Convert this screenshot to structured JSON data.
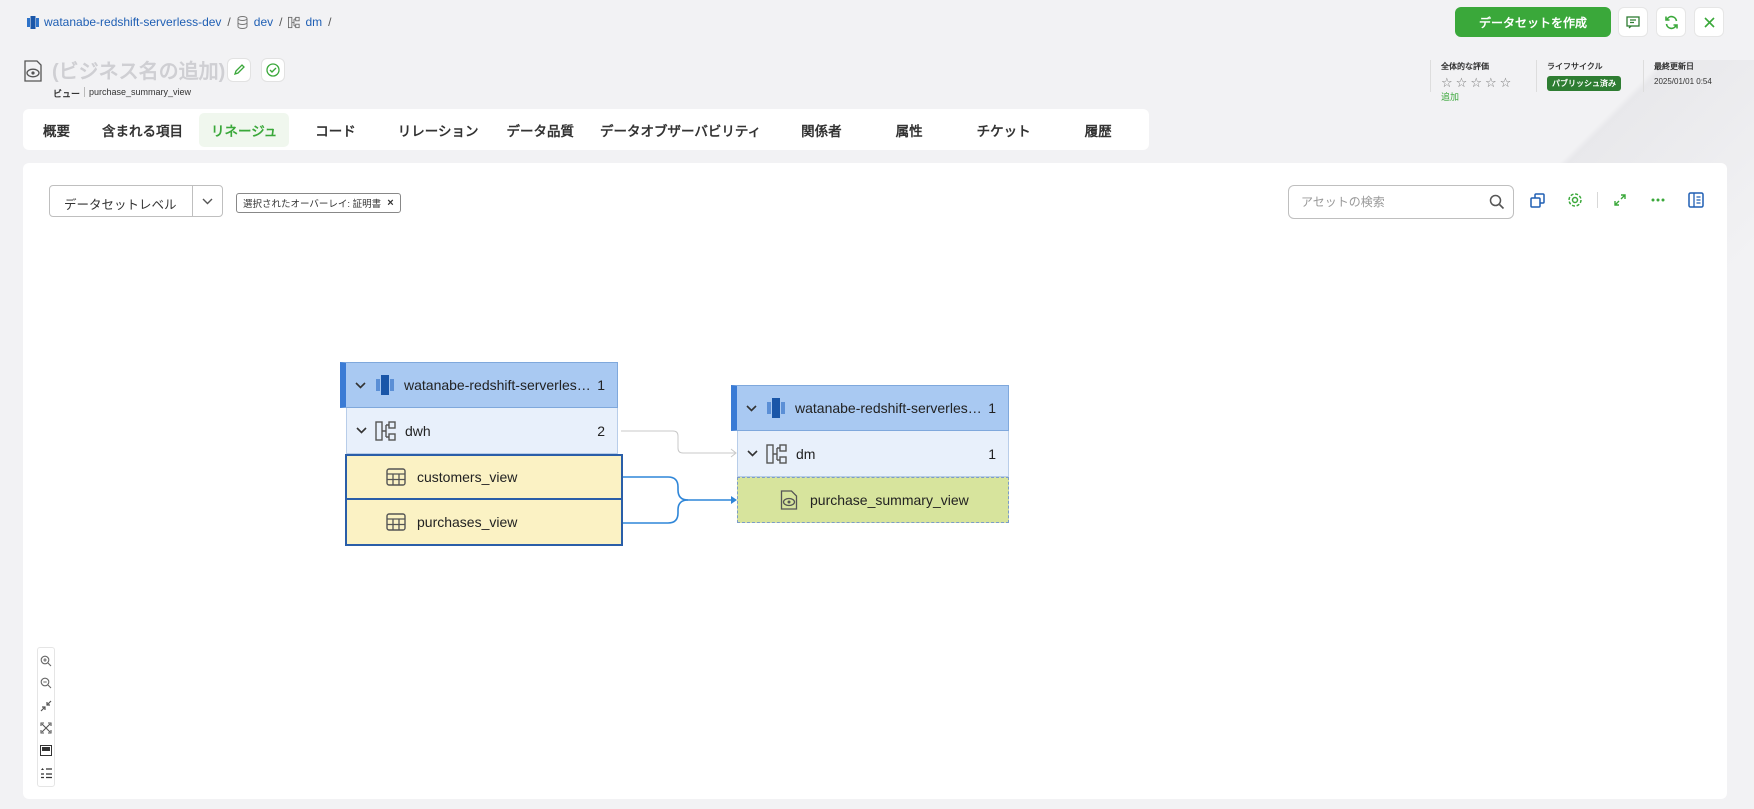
{
  "breadcrumb": [
    {
      "label": "watanabe-redshift-serverless-dev",
      "icon": "redshift-icon"
    },
    {
      "label": "dev",
      "icon": "database-icon"
    },
    {
      "label": "dm",
      "icon": "schema-icon"
    }
  ],
  "breadcrumb_sep": "/",
  "actions": {
    "create_dataset": "データセットを作成"
  },
  "asset": {
    "title": "(ビジネス名の追加)",
    "type_label": "ビュー",
    "name": "purchase_summary_view"
  },
  "meta": {
    "rating_label": "全体的な評価",
    "rating_add": "追加",
    "lifecycle_label": "ライフサイクル",
    "lifecycle_value": "パブリッシュ済み",
    "updated_label": "最終更新日",
    "updated_value": "2025/01/01 0:54"
  },
  "tabs": [
    "概要",
    "含まれる項目",
    "リネージュ",
    "コード",
    "リレーション",
    "データ品質",
    "データオブザーバビリティ",
    "関係者",
    "属性",
    "チケット",
    "履歴"
  ],
  "active_tab": "リネージュ",
  "lineage": {
    "level_select": "データセットレベル",
    "overlay_chip": "選択されたオーバーレイ: 証明書",
    "chip_close": "×",
    "search_placeholder": "アセットの検索",
    "source": {
      "db_name": "watanabe-redshift-serverless-dev",
      "db_count": "1",
      "schema_name": "dwh",
      "schema_count": "2",
      "tables": [
        "customers_view",
        "purchases_view"
      ]
    },
    "target": {
      "db_name": "watanabe-redshift-serverless-dev",
      "db_count": "1",
      "schema_name": "dm",
      "schema_count": "1",
      "view": "purchase_summary_view"
    }
  },
  "colors": {
    "accent": "#3aa83a",
    "link": "#1f5fb4",
    "edge": "#2f86d8",
    "source_leaf": "#fbf2c4",
    "target_leaf": "#d7e49d"
  }
}
